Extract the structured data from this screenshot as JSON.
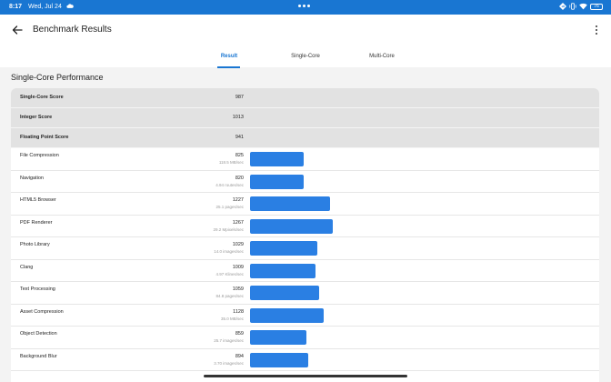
{
  "status_bar": {
    "time": "8:17",
    "date": "Wed, Jul 24",
    "battery": "76"
  },
  "app_bar": {
    "title": "Benchmark Results",
    "tabs": [
      {
        "label": "Result",
        "active": true
      },
      {
        "label": "Single-Core",
        "active": false
      },
      {
        "label": "Multi-Core",
        "active": false
      }
    ]
  },
  "section": {
    "title": "Single-Core Performance"
  },
  "summary": [
    {
      "label": "Single-Core Score",
      "score": "987"
    },
    {
      "label": "Integer Score",
      "score": "1013"
    },
    {
      "label": "Floating Point Score",
      "score": "941"
    }
  ],
  "benchmarks": [
    {
      "name": "File Compression",
      "score": "825",
      "rate": "118.5 MB/sec",
      "value": 825
    },
    {
      "name": "Navigation",
      "score": "820",
      "rate": "4.94 routes/sec",
      "value": 820
    },
    {
      "name": "HTML5 Browser",
      "score": "1227",
      "rate": "25.1 pages/sec",
      "value": 1227
    },
    {
      "name": "PDF Renderer",
      "score": "1267",
      "rate": "29.2 Mpixels/sec",
      "value": 1267
    },
    {
      "name": "Photo Library",
      "score": "1029",
      "rate": "14.0 images/sec",
      "value": 1029
    },
    {
      "name": "Clang",
      "score": "1009",
      "rate": "4.97 Klines/sec",
      "value": 1009
    },
    {
      "name": "Text Processing",
      "score": "1059",
      "rate": "84.8 pages/sec",
      "value": 1059
    },
    {
      "name": "Asset Compression",
      "score": "1128",
      "rate": "35.0 MB/sec",
      "value": 1128
    },
    {
      "name": "Object Detection",
      "score": "859",
      "rate": "25.7 images/sec",
      "value": 859
    },
    {
      "name": "Background Blur",
      "score": "894",
      "rate": "3.70 images/sec",
      "value": 894
    }
  ],
  "colors": {
    "accent": "#1976d2",
    "bar": "#2a7fe3"
  }
}
